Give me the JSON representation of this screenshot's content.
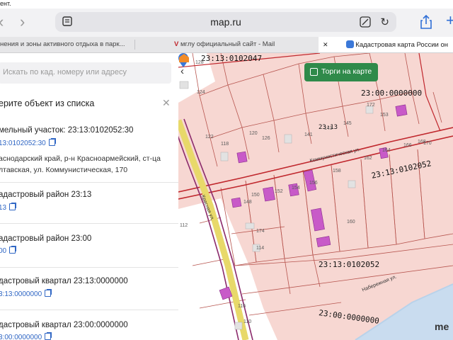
{
  "status": {
    "left_text": "ент."
  },
  "browser": {
    "url": "map.ru",
    "tabs": [
      {
        "label": "нения и зоны активного отдыха в парк..."
      },
      {
        "label": "мглу официальный сайт - Mail"
      },
      {
        "label": "Кадастровая карта России он"
      }
    ]
  },
  "sidebar": {
    "search_placeholder": "Искать по кад. номеру или адресу",
    "select_title": "ерите объект из списка",
    "items": [
      {
        "title": "мельный участок: 23:13:0102052:30",
        "link": "13:0102052:30",
        "address_line1": "аснодарский край, р-н Красноармейский, ст-ца",
        "address_line2": "лтавская, ул. Коммунистическая, 170"
      },
      {
        "title": "адастровый район 23:13",
        "link": "13"
      },
      {
        "title": "адастровый район 23:00",
        "link": "00"
      },
      {
        "title": "дастровый квартал 23:13:0000000",
        "link": "3:13:0000000"
      },
      {
        "title": "дастровый квартал 23:00:0000000",
        "link": "3:00:0000000"
      }
    ]
  },
  "map": {
    "torgi_label": "Торги на карте",
    "labels": {
      "top": "23:13:0102047",
      "right_upper": "23:00:0000000",
      "right_mid": "23:13:0102052",
      "center": "23:13:0102052",
      "bottom": "23:00:0000000",
      "corner": "23:13"
    },
    "streets": {
      "kommunisticheskaya": "Коммунистическая ул.",
      "naberezhnaya": "Набережная ул.",
      "vertical": "Красная ул."
    },
    "parcels": [
      "128",
      "124",
      "122",
      "118",
      "120",
      "126",
      "141",
      "143",
      "145",
      "153",
      "148",
      "150",
      "152",
      "154",
      "156",
      "158",
      "160",
      "162",
      "164",
      "166",
      "168",
      "170",
      "172",
      "174",
      "114",
      "116",
      "110",
      "112"
    ],
    "brand": "me"
  },
  "colors": {
    "accent": "#2f8a4a",
    "link": "#2f66c4",
    "boundary": "#c0272d",
    "parcel_fill": "#f7d7d2",
    "highlight": "#c85ac8"
  }
}
